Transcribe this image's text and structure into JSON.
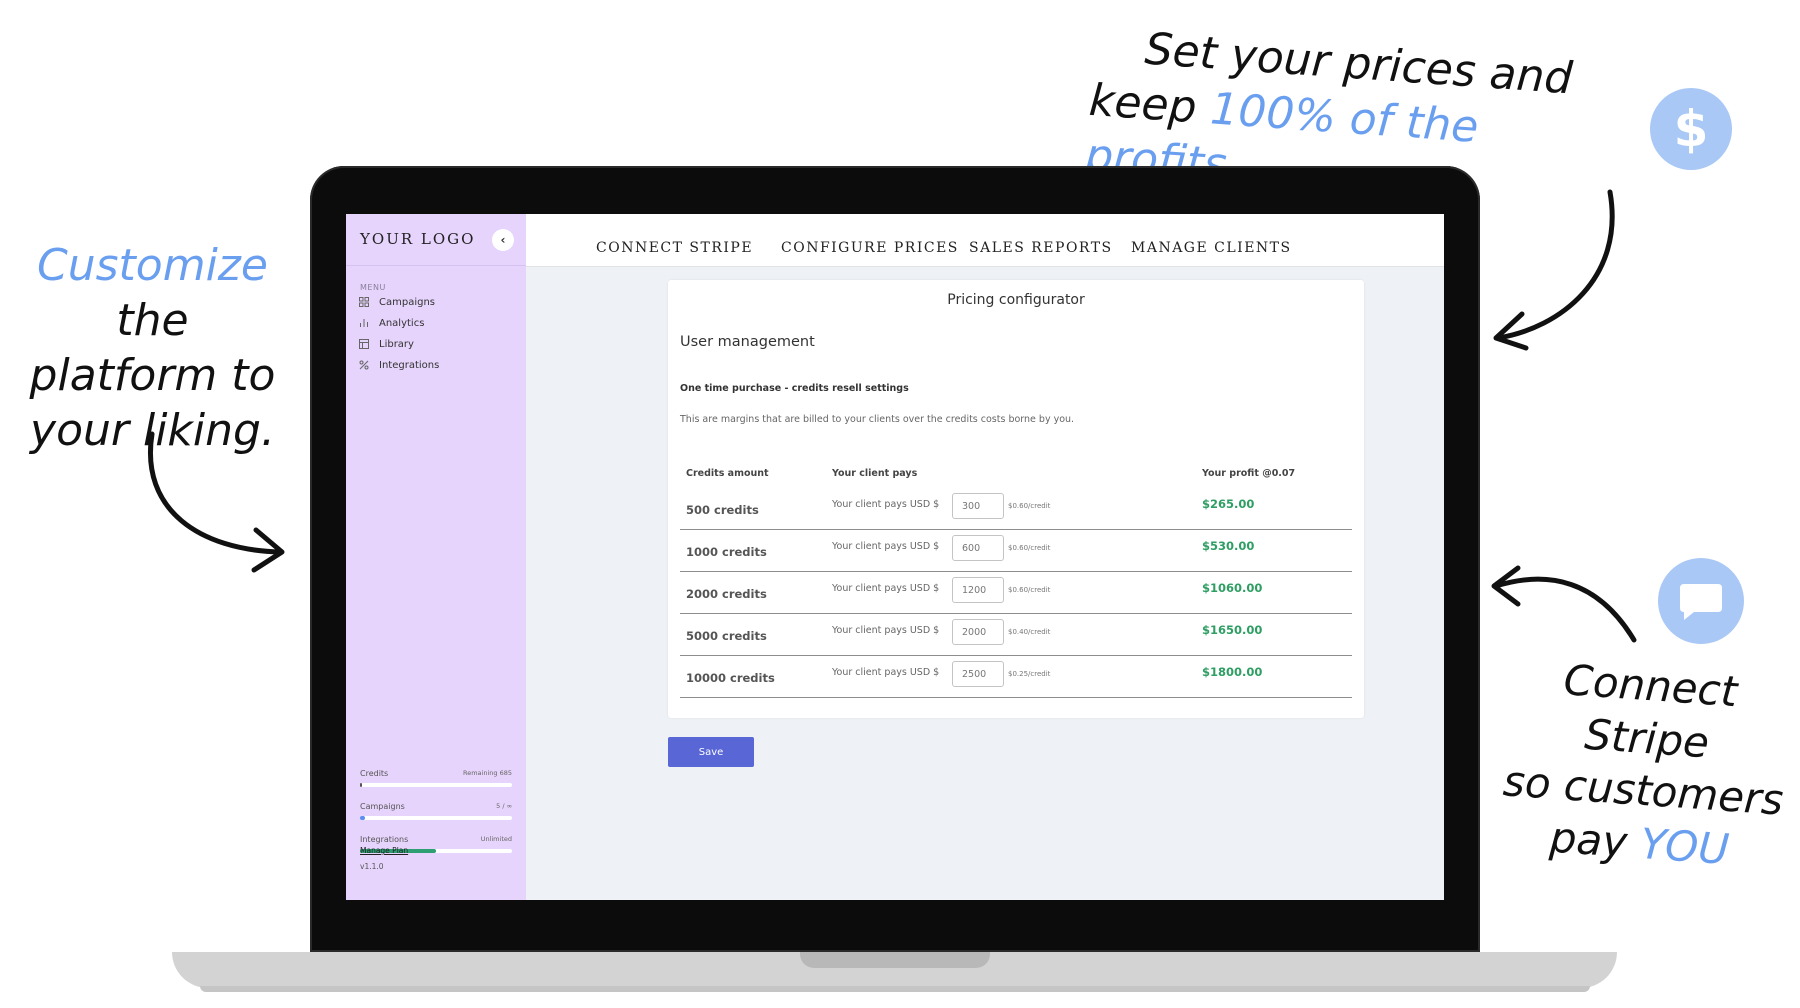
{
  "callouts": {
    "left": {
      "highlight": "Customize",
      "rest1": " the",
      "line2": "platform to",
      "line3": "your liking."
    },
    "top": {
      "line1": "Set your prices and",
      "line2_prefix": "keep ",
      "line2_highlight": "100% of the profits"
    },
    "right": {
      "line1": "Connect Stripe",
      "line2": "so customers",
      "line3_prefix": "pay ",
      "line3_highlight": "YOU"
    },
    "dollar_symbol": "$"
  },
  "colors": {
    "highlight": "#6a9ff0",
    "badge": "#a9c8f6",
    "sidebar": "#e6d4fc",
    "profit": "#2e9e63",
    "save": "#5866d6"
  },
  "sidebar": {
    "logo": "YOUR LOGO",
    "collapse_icon": "‹",
    "menu_label": "MENU",
    "items": [
      {
        "label": "Campaigns",
        "icon": "grid-icon"
      },
      {
        "label": "Analytics",
        "icon": "bar-chart-icon"
      },
      {
        "label": "Library",
        "icon": "book-icon"
      },
      {
        "label": "Integrations",
        "icon": "plug-icon"
      }
    ],
    "usage": [
      {
        "label": "Credits",
        "right": "Remaining 685",
        "fill": 0.01,
        "color": "#555555"
      },
      {
        "label": "Campaigns",
        "right": "5 / ∞",
        "fill": 0.03,
        "color": "#5b8ef0"
      },
      {
        "label": "Integrations",
        "right": "Unlimited",
        "fill": 0.5,
        "color": "#2e9e73"
      }
    ],
    "manage_plan": "Manage Plan",
    "version": "v1.1.0"
  },
  "topnav": {
    "items": [
      "CONNECT STRIPE",
      "CONFIGURE PRICES",
      "SALES REPORTS",
      "MANAGE CLIENTS"
    ]
  },
  "card": {
    "title": "Pricing configurator",
    "section": "User management",
    "subtitle": "One time purchase - credits resell settings",
    "description": "This are margins that are billed to your clients over the credits costs borne by you.",
    "headers": {
      "amount": "Credits amount",
      "pays": "Your client pays",
      "profit": "Your profit @0.07"
    },
    "rows": [
      {
        "amount": "500 credits",
        "pays": "Your client pays USD $",
        "value": "300",
        "rate": "$0.60/credit",
        "profit": "$265.00"
      },
      {
        "amount": "1000 credits",
        "pays": "Your client pays USD $",
        "value": "600",
        "rate": "$0.60/credit",
        "profit": "$530.00"
      },
      {
        "amount": "2000 credits",
        "pays": "Your client pays USD $",
        "value": "1200",
        "rate": "$0.60/credit",
        "profit": "$1060.00"
      },
      {
        "amount": "5000 credits",
        "pays": "Your client pays USD $",
        "value": "2000",
        "rate": "$0.40/credit",
        "profit": "$1650.00"
      },
      {
        "amount": "10000 credits",
        "pays": "Your client pays USD $",
        "value": "2500",
        "rate": "$0.25/credit",
        "profit": "$1800.00"
      }
    ]
  },
  "save_label": "Save"
}
